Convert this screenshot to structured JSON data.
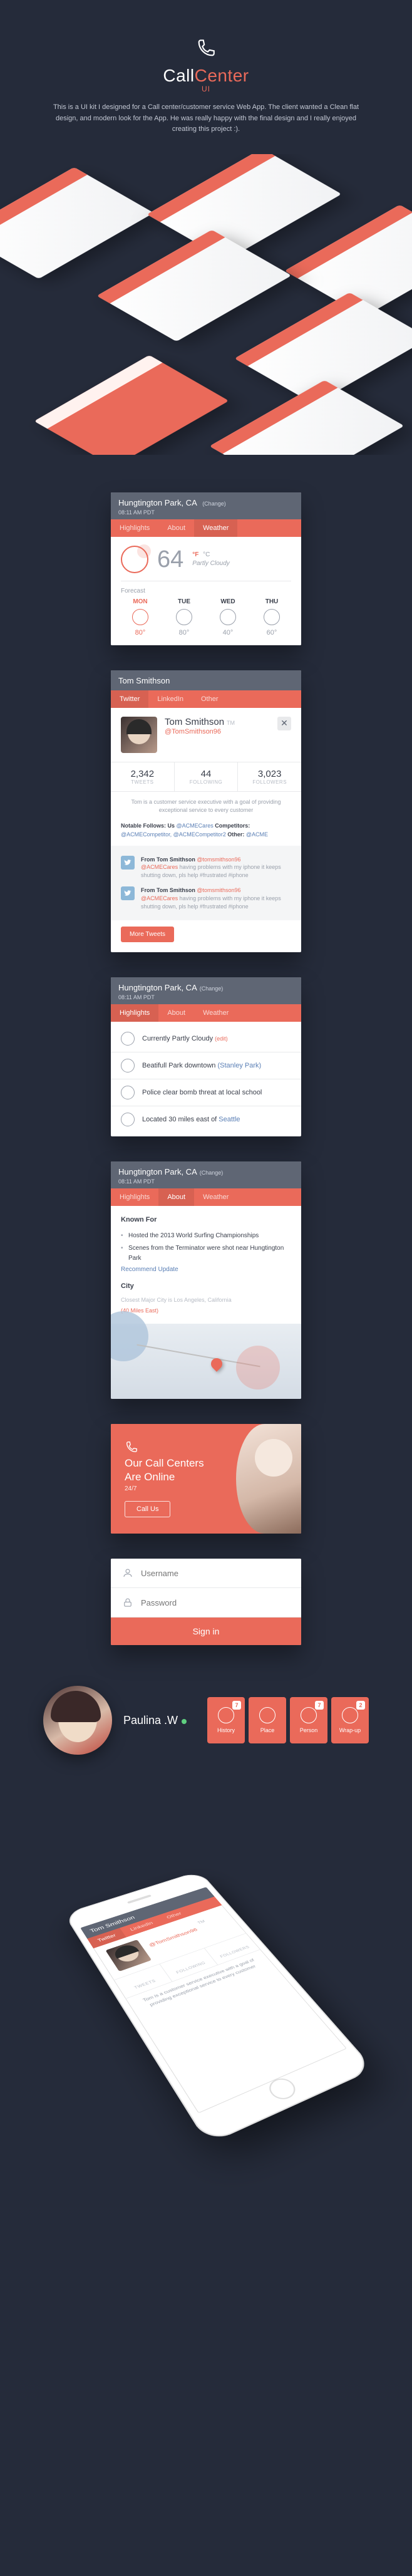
{
  "hero": {
    "title_part1": "Call",
    "title_part2": "Center",
    "title_suffix": "UI",
    "description": "This is a UI kit I designed for a Call center/customer service Web App. The client wanted a Clean flat design, and modern look for the App. He was really happy with the final design and I really enjoyed creating this project :)."
  },
  "location": {
    "city": "Hungtington Park, CA",
    "change_label": "(Change)",
    "time": "08:11 AM PDT"
  },
  "weather": {
    "tabs": [
      "Highlights",
      "About",
      "Weather"
    ],
    "active_tab": 2,
    "temp": "64",
    "unit_f": "°F",
    "unit_c": "°C",
    "condition": "Partly Cloudy",
    "forecast_label": "Forecast",
    "forecast": [
      {
        "day": "MON",
        "temp": "80°"
      },
      {
        "day": "TUE",
        "temp": "80°"
      },
      {
        "day": "WED",
        "temp": "40°"
      },
      {
        "day": "THU",
        "temp": "60°"
      }
    ],
    "selected_day": 0
  },
  "profile": {
    "header_name": "Tom Smithson",
    "name": "Tom Smithson",
    "tm": "TM",
    "handle": "@TomSmithson96",
    "tabs": [
      "Twitter",
      "LinkedIn",
      "Other"
    ],
    "active_tab": 0,
    "stats": [
      {
        "n": "2,342",
        "l": "TWEETS"
      },
      {
        "n": "44",
        "l": "FOLLOWING"
      },
      {
        "n": "3,023",
        "l": "FOLLOWERS"
      }
    ],
    "bio": "Tom is a customer service executive with a goal of providing exceptional service to every customer",
    "notable_label": "Notable Follows:",
    "notable_us_label": "Us",
    "notable_us": "@ACMECares",
    "notable_comp_label": "Competitors:",
    "notable_comp": "@ACMECompetitor, @ACMECompetitor2",
    "notable_other_label": "Other:",
    "notable_other": "@ACME",
    "tweets": [
      {
        "from": "From Tom Smithson",
        "handle": "@tomsmithson96",
        "mention": "@ACMECares",
        "body": " having problems with my iphone it keeps shutting down, pls help #frustrated #iphone"
      },
      {
        "from": "From Tom Smithson",
        "handle": "@tomsmithson96",
        "mention": "@ACMECares",
        "body": " having problems with my iphone it keeps shutting down, pls help #frustrated #iphone"
      }
    ],
    "more_tweets": "More Tweets"
  },
  "highlights": {
    "tabs": [
      "Highlights",
      "About",
      "Weather"
    ],
    "active_tab": 0,
    "items": [
      {
        "text": "Currently Partly Cloudy",
        "edit": "(edit)"
      },
      {
        "text": "Beatifull Park downtown",
        "link": "(Stanley Park)"
      },
      {
        "text": "Police clear bomb threat at local school"
      },
      {
        "text": "Located 30 miles east of ",
        "link_end": "Seattle"
      }
    ]
  },
  "known_for": {
    "tabs": [
      "Highlights",
      "About",
      "Weather"
    ],
    "active_tab": 1,
    "title": "Known For",
    "items": [
      "Hosted the 2013 World Surfing Championships",
      "Scenes from the Terminator were shot near Hungtington Park"
    ],
    "recommend": "Recommend Update",
    "city_label": "City",
    "city_text": "Closest Major City is Los Angeles, California",
    "distance": "(40 Miles East)"
  },
  "promo": {
    "line1": "Our Call Centers",
    "line2": "Are Online",
    "sub": "24/7",
    "button": "Call Us"
  },
  "login": {
    "username_placeholder": "Username",
    "password_placeholder": "Password",
    "signin": "Sign in"
  },
  "agent": {
    "name": "Paulina .W",
    "tools": [
      {
        "label": "History",
        "badge": "7"
      },
      {
        "label": "Place"
      },
      {
        "label": "Person",
        "badge": "7"
      },
      {
        "label": "Wrap-up",
        "badge": "2"
      }
    ]
  },
  "colors": {
    "coral": "#ea6a5a",
    "grey": "#5f6674",
    "bg": "#252b3a"
  }
}
